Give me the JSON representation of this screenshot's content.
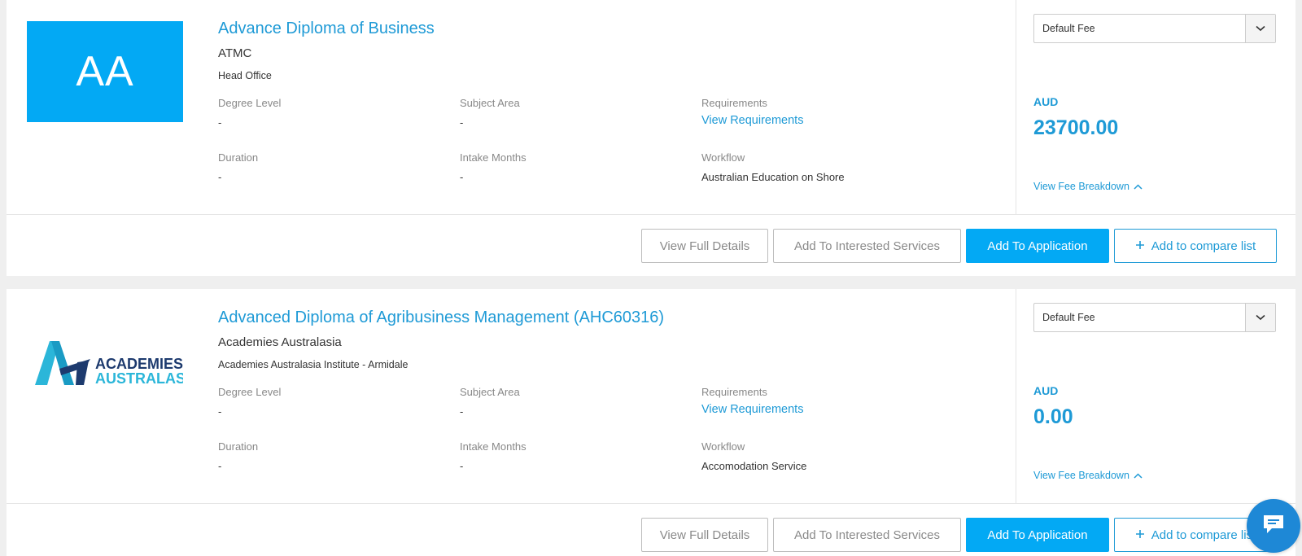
{
  "colors": {
    "accent": "#03a9f4",
    "link": "#1e9ad6",
    "chat": "#1e88d6"
  },
  "courses": [
    {
      "thumb_initials": "AA",
      "title": "Advance Diploma of Business",
      "institution": "ATMC",
      "campus": "Head Office",
      "fields": {
        "degree_level_label": "Degree Level",
        "degree_level": "-",
        "subject_area_label": "Subject Area",
        "subject_area": "-",
        "requirements_label": "Requirements",
        "requirements_link": "View Requirements",
        "duration_label": "Duration",
        "duration": "-",
        "intake_months_label": "Intake Months",
        "intake_months": "-",
        "workflow_label": "Workflow",
        "workflow": "Australian Education on Shore"
      },
      "fee": {
        "select_value": "Default Fee",
        "currency": "AUD",
        "amount": "23700.00",
        "breakdown_label": "View Fee Breakdown"
      },
      "actions": {
        "view_full": "View Full Details",
        "interested": "Add To Interested Services",
        "add_application": "Add To Application",
        "compare": "Add to compare list"
      }
    },
    {
      "logo_text": {
        "line1": "ACADEMIES",
        "line2": "AUSTRALASIA"
      },
      "title": "Advanced Diploma of Agribusiness Management (AHC60316)",
      "institution": "Academies Australasia",
      "campus": "Academies Australasia Institute - Armidale",
      "fields": {
        "degree_level_label": "Degree Level",
        "degree_level": "-",
        "subject_area_label": "Subject Area",
        "subject_area": "-",
        "requirements_label": "Requirements",
        "requirements_link": "View Requirements",
        "duration_label": "Duration",
        "duration": "-",
        "intake_months_label": "Intake Months",
        "intake_months": "-",
        "workflow_label": "Workflow",
        "workflow": "Accomodation Service"
      },
      "fee": {
        "select_value": "Default Fee",
        "currency": "AUD",
        "amount": "0.00",
        "breakdown_label": "View Fee Breakdown"
      },
      "actions": {
        "view_full": "View Full Details",
        "interested": "Add To Interested Services",
        "add_application": "Add To Application",
        "compare": "Add to compare list"
      }
    }
  ],
  "icons": {
    "select_arrow": "chevron-down-icon",
    "breakdown": "chevron-up-icon",
    "compare": "plus-icon",
    "chat": "chat-icon"
  }
}
